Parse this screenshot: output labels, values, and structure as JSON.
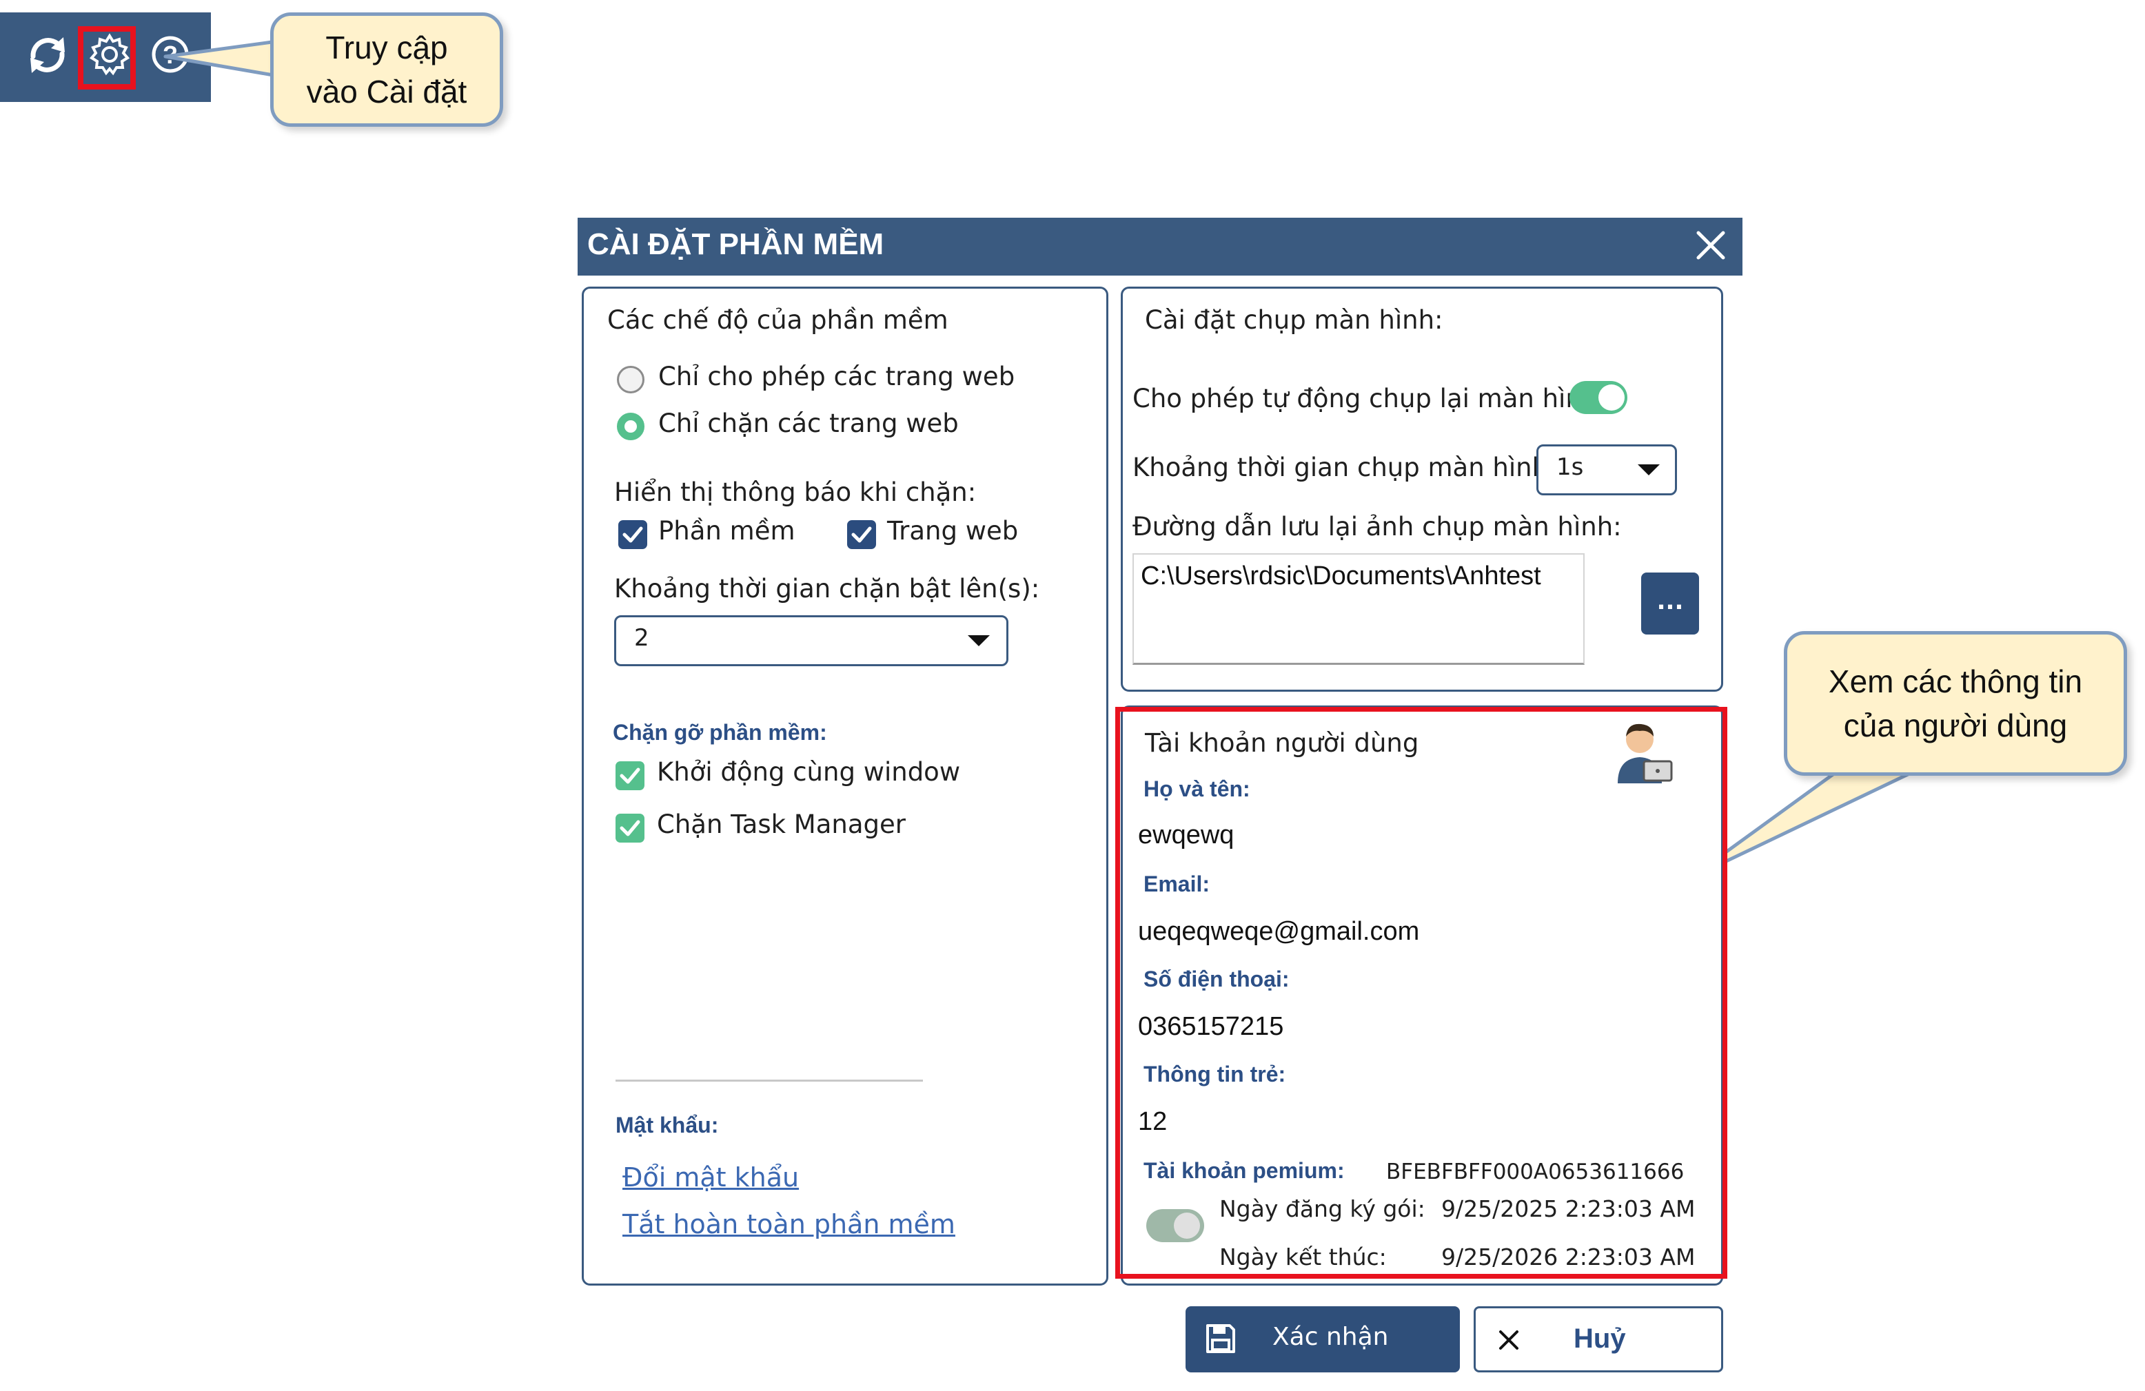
{
  "toolbar": {
    "icons": [
      "refresh-icon",
      "gear-icon",
      "help-icon"
    ],
    "highlight_color": "#e8121e"
  },
  "callouts": {
    "settings_access": [
      "Truy cập",
      "vào Cài đặt"
    ],
    "user_info": [
      "Xem các thông tin",
      "của người dùng"
    ]
  },
  "dialog": {
    "title": "CÀI ĐẶT PHẦN MỀM",
    "modes": {
      "heading": "Các chế độ của phần mềm",
      "options": [
        "Chỉ cho phép các trang web",
        "Chỉ chặn các trang web"
      ],
      "selected_index": 1
    },
    "notify": {
      "heading": "Hiển thị thông báo khi chặn:",
      "software_label": "Phần mềm",
      "software_checked": true,
      "web_label": "Trang web",
      "web_checked": true
    },
    "block_interval": {
      "label": "Khoảng thời gian chặn bật lên(s):",
      "value": "2"
    },
    "uninstall_block": {
      "heading": "Chặn gỡ phần mềm:",
      "startup_label": "Khởi động cùng window",
      "startup_checked": true,
      "taskmgr_label": "Chặn Task Manager",
      "taskmgr_checked": true
    },
    "password": {
      "heading": "Mật khẩu:",
      "change_link": "Đổi mật khẩu",
      "disable_link": "Tắt hoàn toàn phần mềm"
    },
    "screenshot": {
      "heading": "Cài đặt chụp màn hình:",
      "auto_label": "Cho phép tự động chụp lại màn hình",
      "auto_enabled": true,
      "interval_label": "Khoảng thời gian chụp màn hình:",
      "interval_value": "1s",
      "path_label": "Đường dẫn lưu lại ảnh chụp màn hình:",
      "path_value": "C:\\Users\\rdsic\\Documents\\Anhtest",
      "browse_label": "..."
    },
    "account": {
      "heading": "Tài khoản người dùng",
      "name_label": "Họ và tên:",
      "name_value": "ewqewq",
      "email_label": "Email:",
      "email_value": "ueqeqweqe@gmail.com",
      "phone_label": "Số điện thoại:",
      "phone_value": "0365157215",
      "child_label": "Thông tin trẻ:",
      "child_value": "12",
      "premium_label": "Tài khoản pemium:",
      "premium_value": "BFEBFBFF000A0653611666",
      "premium_enabled": true,
      "register_label": "Ngày đăng ký gói:",
      "register_value": "9/25/2025 2:23:03 AM",
      "end_label": "Ngày kết thúc:",
      "end_value": "9/25/2026 2:23:03 AM"
    },
    "buttons": {
      "confirm": "Xác nhận",
      "cancel": "Huỷ"
    }
  },
  "colors": {
    "header": "#3a5a80",
    "accent_green": "#55c08d",
    "callout_fill": "#fff2cc",
    "highlight": "#e8121e"
  }
}
